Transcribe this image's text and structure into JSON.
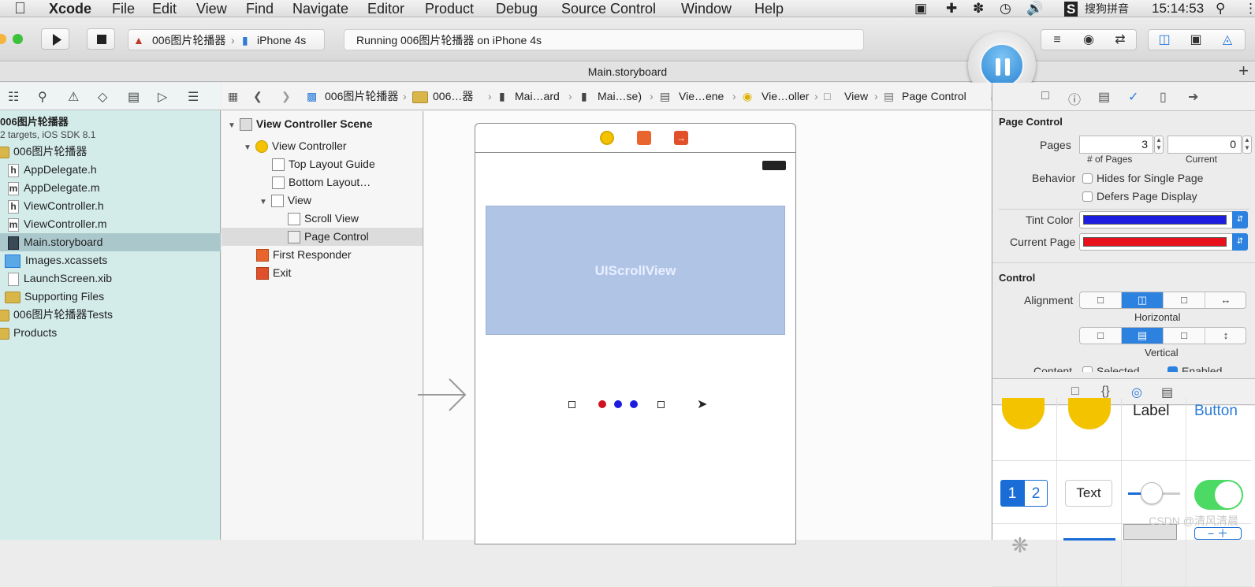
{
  "menubar": {
    "apple": "",
    "app": "Xcode",
    "items": [
      "File",
      "Edit",
      "View",
      "Find",
      "Navigate",
      "Editor",
      "Product",
      "Debug",
      "Source Control",
      "Window",
      "Help"
    ],
    "input_method": "搜狗拼音",
    "time": "15:14:53"
  },
  "toolbar": {
    "scheme_project": "006图片轮播器",
    "scheme_device": "iPhone 4s",
    "activity": "Running 006图片轮播器 on iPhone 4s"
  },
  "tab": {
    "title": "Main.storyboard"
  },
  "navigator": {
    "project_name": "006图片轮播器",
    "project_sub": "2 targets, iOS SDK 8.1",
    "items": [
      {
        "label": "006图片轮播器",
        "type": "folder"
      },
      {
        "label": "AppDelegate.h",
        "type": "h"
      },
      {
        "label": "AppDelegate.m",
        "type": "m"
      },
      {
        "label": "ViewController.h",
        "type": "h"
      },
      {
        "label": "ViewController.m",
        "type": "m"
      },
      {
        "label": "Main.storyboard",
        "type": "storyboard"
      },
      {
        "label": "Images.xcassets",
        "type": "assets"
      },
      {
        "label": "LaunchScreen.xib",
        "type": "xib"
      },
      {
        "label": "Supporting Files",
        "type": "folder"
      },
      {
        "label": "006图片轮播器Tests",
        "type": "folder"
      },
      {
        "label": "Products",
        "type": "folder"
      }
    ]
  },
  "jumpbar": {
    "segments": [
      "006图片轮播器",
      "006…器",
      "Mai…ard",
      "Mai…se)",
      "Vie…ene",
      "Vie…oller",
      "View",
      "Page Control"
    ]
  },
  "outline": {
    "items": [
      {
        "label": "View Controller Scene"
      },
      {
        "label": "View Controller"
      },
      {
        "label": "Top Layout Guide"
      },
      {
        "label": "Bottom Layout…"
      },
      {
        "label": "View"
      },
      {
        "label": "Scroll View"
      },
      {
        "label": "Page Control"
      },
      {
        "label": "First Responder"
      },
      {
        "label": "Exit"
      }
    ]
  },
  "canvas": {
    "scroll_view_label": "UIScrollView",
    "page_dots": [
      "#d0141f",
      "#1d1de0",
      "#1d1de0"
    ]
  },
  "inspector": {
    "section_page_control": "Page Control",
    "pages_label": "Pages",
    "pages_value": "3",
    "pages_caption": "# of Pages",
    "current_value": "0",
    "current_caption": "Current",
    "behavior_label": "Behavior",
    "hides_label": "Hides for Single Page",
    "defers_label": "Defers Page Display",
    "tint_label": "Tint Color",
    "tint_color": "#1d1de0",
    "current_page_label": "Current Page",
    "current_page_color": "#e8101a",
    "section_control": "Control",
    "alignment_label": "Alignment",
    "horizontal_caption": "Horizontal",
    "vertical_caption": "Vertical",
    "content_label": "Content",
    "selected_label": "Selected",
    "enabled_label": "Enabled"
  },
  "library": {
    "label_text": "Label",
    "button_text": "Button",
    "seg_1": "1",
    "seg_2": "2",
    "textfield_text": "Text"
  },
  "watermark": "CSDN @清风清晨"
}
